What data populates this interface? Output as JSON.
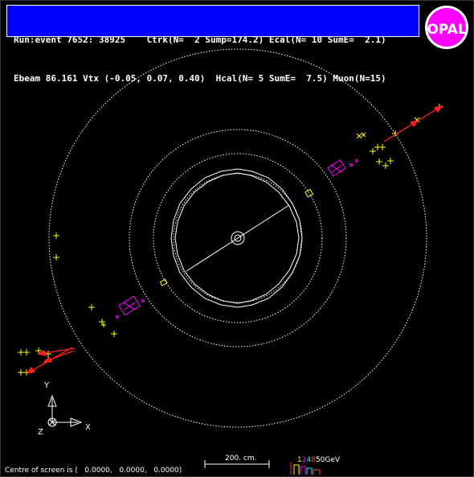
{
  "header": {
    "line1": "Run:event 7652: 38925    Ctrk(N=  2 Sump=174.2) Ecal(N= 10 SumE=  2.1)",
    "line2": "Ebeam 86.161 Vtx (-0.05, 0.07, 0.40)  Hcal(N= 5 SumE=  7.5) Muon(N=15)"
  },
  "logo": {
    "text": "OPAL"
  },
  "axes": {
    "y": "Y",
    "x": "X",
    "z": "Z"
  },
  "scale": {
    "label": "200. cm."
  },
  "energy_scale": {
    "digits": [
      "1",
      "2",
      "4",
      "8",
      "50"
    ],
    "unit": "GeV",
    "colors": [
      "#ffff00",
      "#ff00ff",
      "#00ffff",
      "#ff4444",
      "#ffffff"
    ]
  },
  "footer": {
    "text": "Centre of screen is (   0.0000,   0.0000,   0.0000)"
  },
  "colors": {
    "background": "#000000",
    "header_bg": "#0000ff",
    "track": "#ffffff",
    "ecal": "#ffff00",
    "hcal": "#ff00ff",
    "muon": "#ff2020"
  }
}
